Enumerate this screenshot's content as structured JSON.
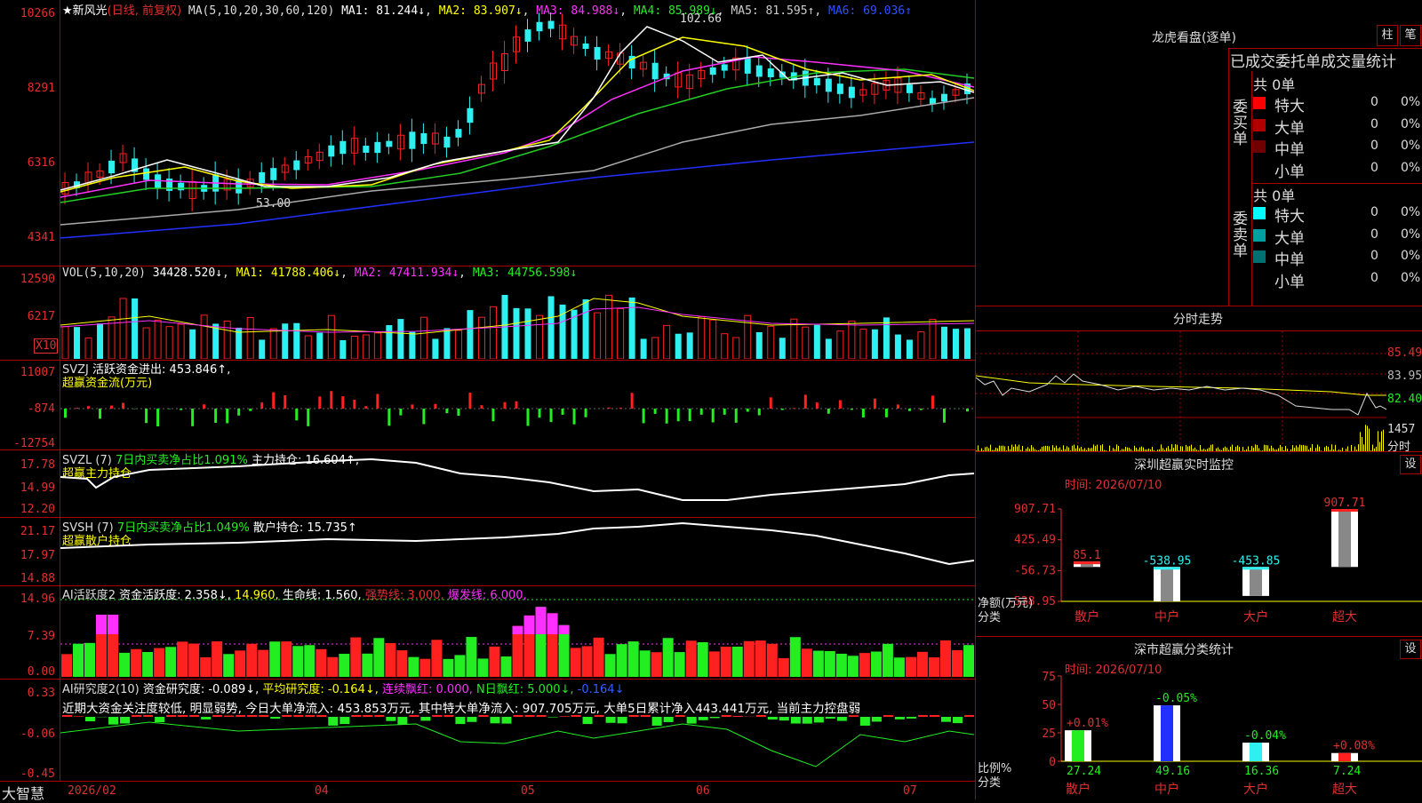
{
  "stock": {
    "name": "★新风光",
    "period_label": "(日线, 前复权)",
    "ma_line": "MA(5,10,20,30,60,120)",
    "ma1": "MA1: 81.244↓",
    "ma2": "MA2: 83.907↓",
    "ma3": "MA3: 84.988↓",
    "ma4": "MA4: 85.989↓",
    "ma5": "MA5: 81.595↑",
    "ma6": "MA6: 69.036↑",
    "high_mark": "102.66",
    "low_mark": "53.00",
    "yaxis": [
      "10266",
      "8291",
      "6316",
      "4341"
    ]
  },
  "vol": {
    "label": "VOL(5,10,20)",
    "value": "34428.520↓",
    "ma1": "MA1: 41788.406↓",
    "ma2": "MA2: 47411.934↓",
    "ma3": "MA3: 44756.598↓",
    "yaxis": [
      "12590",
      "6217"
    ],
    "unit": "X10"
  },
  "svzj": {
    "label": "SVZJ",
    "text": "活跃资金进出: 453.846↑,",
    "sub": "超赢资金流(万元)",
    "yaxis": [
      "11007",
      "-874",
      "-12754"
    ]
  },
  "svzl": {
    "label": "SVZL (7)",
    "text1": "7日内买卖净占比1.091%",
    "text2": "主力持仓: 16.604↑,",
    "sub": "超赢主力持仓",
    "yaxis": [
      "17.78",
      "14.99",
      "12.20"
    ]
  },
  "svsh": {
    "label": "SVSH (7)",
    "text1": "7日内买卖净占比1.049%",
    "text2": "散户持仓: 15.735↑",
    "sub": "超赢散户持仓",
    "yaxis": [
      "21.17",
      "17.97",
      "14.88"
    ]
  },
  "ai1": {
    "label": "AI活跃度2",
    "t1": "资金活跃度: 2.358↓,",
    "t2": "14.960,",
    "t3": "生命线: 1.560,",
    "t4": "强势线: 3.000,",
    "t5": "爆发线: 6.000,",
    "yaxis": [
      "14.96",
      "7.39",
      "0.00"
    ]
  },
  "ai2": {
    "label": "AI研究度2(10)",
    "t1": "资金研究度: -0.089↓,",
    "t2": "平均研究度: -0.164↓,",
    "t3": "连续飘红: 0.000,",
    "t4": "N日飘红: 5.000↓,",
    "t5": "-0.164↓",
    "desc": "近期大资金关注度较低, 明显弱势, 今日大单净流入: 453.853万元, 其中特大单净流入: 907.705万元, 大单5日累计净入443.441万元, 当前主力控盘弱",
    "yaxis": [
      "0.33",
      "-0.06",
      "-0.45"
    ]
  },
  "bottom": {
    "brand": "大智慧",
    "months": [
      "2026/02",
      "04",
      "05",
      "06",
      "07"
    ]
  },
  "lhb": {
    "title": "龙虎看盘(逐单)",
    "btn1": "柱",
    "btn2": "笔",
    "tabs": "已成交委托单成交量统计",
    "buy_label": "委买单",
    "sell_label": "委卖单",
    "buy_total": "共 0单",
    "sell_total": "共 0单",
    "buy_rows": [
      {
        "name": "特大",
        "count": "0",
        "pct": "0%",
        "color": "#ff0000"
      },
      {
        "name": "大单",
        "count": "0",
        "pct": "0%",
        "color": "#b00000"
      },
      {
        "name": "中单",
        "count": "0",
        "pct": "0%",
        "color": "#700000"
      },
      {
        "name": "小单",
        "count": "0",
        "pct": "0%",
        "color": "#000000"
      }
    ],
    "sell_rows": [
      {
        "name": "特大",
        "count": "0",
        "pct": "0%",
        "color": "#00ffff"
      },
      {
        "name": "大单",
        "count": "0",
        "pct": "0%",
        "color": "#00a0a0"
      },
      {
        "name": "中单",
        "count": "0",
        "pct": "0%",
        "color": "#007070"
      },
      {
        "name": "小单",
        "count": "0",
        "pct": "0%",
        "color": "#000000"
      }
    ]
  },
  "fenshi": {
    "title": "分时走势",
    "yaxis": [
      "85.49",
      "83.95",
      "82.40"
    ],
    "vol_label": "1457",
    "sub_label": "分时"
  },
  "monitor": {
    "title": "深圳超赢实时监控",
    "btn": "设",
    "time": "时间: 2026/07/10",
    "yaxis": [
      "907.71",
      "425.49",
      "-56.73",
      "-538.95"
    ],
    "ylabel1": "净额(万元)",
    "ylabel2": "分类",
    "categories": [
      "散户",
      "中户",
      "大户",
      "超大"
    ],
    "values": [
      85.1,
      -538.95,
      -453.85,
      907.71
    ],
    "value_labels": [
      "85.1",
      "-538.95",
      "-453.85",
      "907.71"
    ]
  },
  "classify": {
    "title": "深市超赢分类统计",
    "btn": "设",
    "time": "时间: 2026/07/10",
    "yaxis": [
      "75",
      "50",
      "25",
      "0"
    ],
    "ylabel1": "比例%",
    "ylabel2": "分类",
    "categories": [
      "散户",
      "中户",
      "大户",
      "超大"
    ],
    "values": [
      27.24,
      49.16,
      16.36,
      7.24
    ],
    "value_labels": [
      "27.24",
      "49.16",
      "16.36",
      "7.24"
    ],
    "change_labels": [
      "+0.01%",
      "-0.05%",
      "-0.04%",
      "+0.08%"
    ]
  }
}
